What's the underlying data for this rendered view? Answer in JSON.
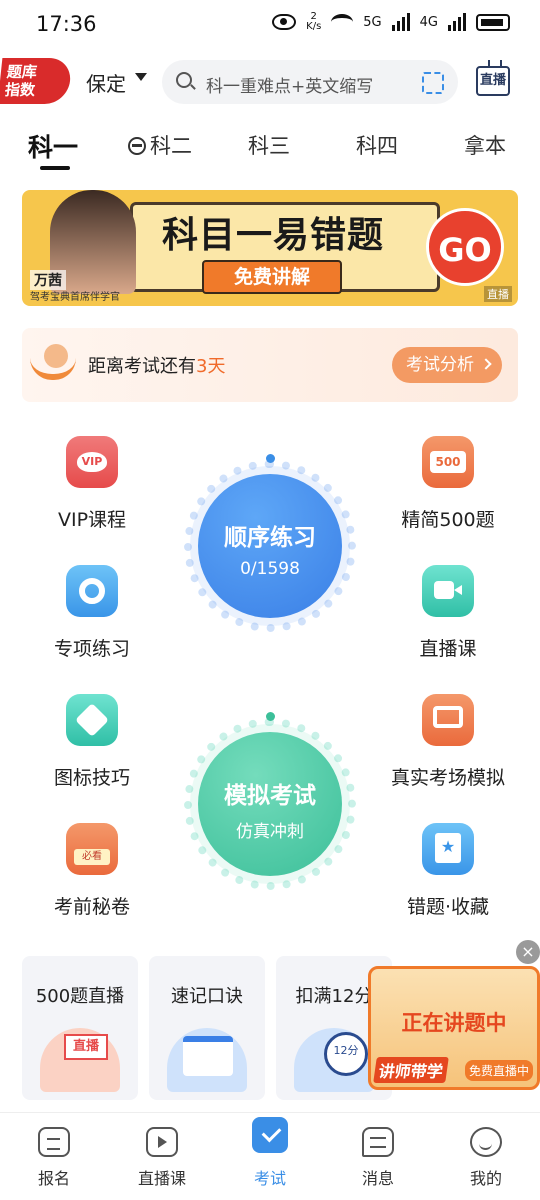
{
  "status_bar": {
    "time": "17:36",
    "net_speed_value": "2",
    "net_speed_unit": "K/s",
    "signal_1": "5G",
    "signal_2": "4G"
  },
  "header": {
    "logo_line1": "题库",
    "logo_line2": "指数",
    "city": "保定",
    "search_placeholder": "科一重难点+英文缩写",
    "live_button": "直播"
  },
  "tabs": [
    {
      "label": "科一",
      "active": true
    },
    {
      "label": "科二",
      "active": false
    },
    {
      "label": "科三",
      "active": false
    },
    {
      "label": "科四",
      "active": false
    },
    {
      "label": "拿本",
      "active": false
    }
  ],
  "banner": {
    "title": "科目一易错题",
    "button": "免费讲解",
    "go": "GO",
    "tag": "直播",
    "presenter_name": "万茜",
    "presenter_title": "驾考宝典首席伴学官"
  },
  "countdown": {
    "text_prefix": "距离考试还有",
    "days": "3天",
    "button": "考试分析"
  },
  "features": {
    "vip": "VIP课程",
    "select500": "精简500题",
    "special": "专项练习",
    "live_class": "直播课",
    "icon_tips": "图标技巧",
    "real_sim": "真实考场模拟",
    "pre_exam": "考前秘卷",
    "mistakes": "错题·收藏"
  },
  "practice_circle": {
    "title": "顺序练习",
    "progress": "0/1598"
  },
  "exam_circle": {
    "title": "模拟考试",
    "subtitle": "仿真冲刺"
  },
  "cards": [
    {
      "title": "500题直播"
    },
    {
      "title": "速记口诀"
    },
    {
      "title": "扣满12分"
    }
  ],
  "float_ad": {
    "title": "正在讲题中",
    "left_tag": "讲师带学",
    "right_tag": "免费直播中",
    "close": "×"
  },
  "bottom_nav": [
    {
      "label": "报名",
      "icon": "signup-icon",
      "active": false
    },
    {
      "label": "直播课",
      "icon": "live-icon",
      "active": false
    },
    {
      "label": "考试",
      "icon": "exam-icon",
      "active": true
    },
    {
      "label": "消息",
      "icon": "message-icon",
      "active": false
    },
    {
      "label": "我的",
      "icon": "profile-icon",
      "active": false
    }
  ],
  "colors": {
    "accent_blue": "#3a8ee6",
    "accent_orange": "#f06a2a",
    "brand_red": "#d92b2b",
    "practice_blue": "#3a7fe6",
    "exam_green": "#3cbf99"
  }
}
